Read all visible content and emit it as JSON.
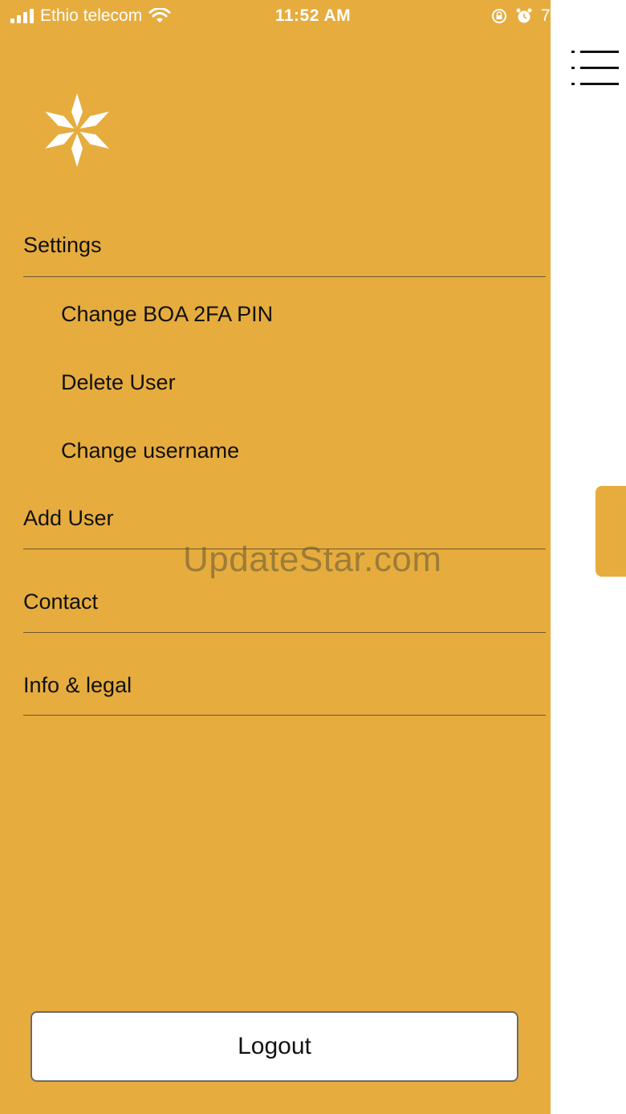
{
  "status_bar": {
    "carrier": "Ethio telecom",
    "time": "11:52 AM",
    "battery_text": "7"
  },
  "drawer": {
    "background_color": "#e6ac3e",
    "logo_icon": "snowflake-icon",
    "settings_label": "Settings",
    "settings_items": [
      "Change BOA 2FA PIN",
      "Delete User",
      "Change username"
    ],
    "add_user_label": "Add User",
    "contact_label": "Contact",
    "info_legal_label": "Info & legal",
    "logout_label": "Logout"
  },
  "header": {
    "menu_icon": "hamburger-menu-icon"
  },
  "watermark": "UpdateStar.com"
}
